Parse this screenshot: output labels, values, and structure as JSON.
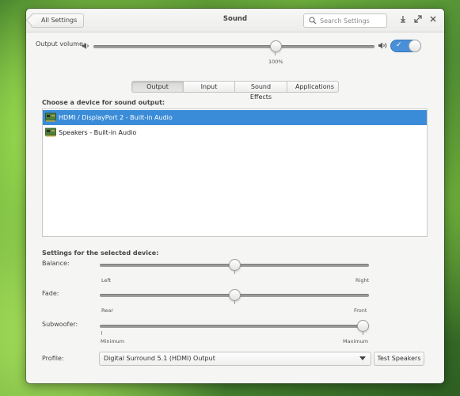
{
  "header": {
    "back_label": "All Settings",
    "title": "Sound",
    "search_placeholder": "Search Settings"
  },
  "output_volume": {
    "label": "Output volume:",
    "value_percent": 100,
    "value_label": "100%",
    "enabled": true
  },
  "tabs": [
    {
      "label": "Output",
      "active": true
    },
    {
      "label": "Input",
      "active": false
    },
    {
      "label": "Sound Effects",
      "active": false
    },
    {
      "label": "Applications",
      "active": false
    }
  ],
  "device_section": {
    "heading": "Choose a device for sound output:",
    "devices": [
      {
        "label": "HDMI / DisplayPort 2 - Built-in Audio",
        "selected": true
      },
      {
        "label": "Speakers - Built-in Audio",
        "selected": false
      }
    ]
  },
  "settings_section": {
    "heading": "Settings for the selected device:",
    "balance": {
      "label": "Balance:",
      "min_label": "Left",
      "max_label": "Right",
      "value": 0.5
    },
    "fade": {
      "label": "Fade:",
      "min_label": "Rear",
      "max_label": "Front",
      "value": 0.5
    },
    "subwoofer": {
      "label": "Subwoofer:",
      "min_label": "Minimum",
      "max_label": "Maximum",
      "value": 1.0
    },
    "profile": {
      "label": "Profile:",
      "selected": "Digital Surround 5.1 (HDMI) Output"
    },
    "test_button": "Test Speakers"
  },
  "colors": {
    "accent": "#3b8cd8",
    "window_bg": "#f5f5f4"
  },
  "icons": [
    "speaker-low-icon",
    "speaker-high-icon",
    "search-icon",
    "download-icon",
    "maximize-icon",
    "close-icon",
    "sound-card-icon"
  ]
}
